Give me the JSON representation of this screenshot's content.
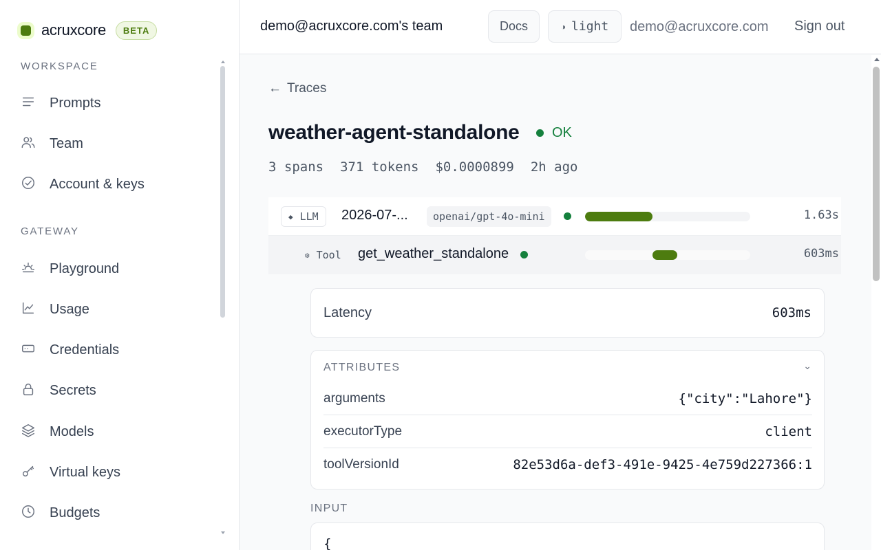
{
  "brand": {
    "name": "acruxcore",
    "badge": "BETA"
  },
  "sidebar": {
    "workspace_label": "WORKSPACE",
    "gateway_label": "GATEWAY",
    "items": [
      {
        "label": "Prompts",
        "icon": "lines-icon"
      },
      {
        "label": "Team",
        "icon": "users-icon"
      },
      {
        "label": "Account & keys",
        "icon": "check-circle-icon"
      },
      {
        "label": "Playground",
        "icon": "sun-icon"
      },
      {
        "label": "Usage",
        "icon": "chart-line-icon"
      },
      {
        "label": "Credentials",
        "icon": "card-icon"
      },
      {
        "label": "Secrets",
        "icon": "lock-icon"
      },
      {
        "label": "Models",
        "icon": "layers-icon"
      },
      {
        "label": "Virtual keys",
        "icon": "key-icon"
      },
      {
        "label": "Budgets",
        "icon": "clock-icon"
      }
    ]
  },
  "header": {
    "team": "demo@acruxcore.com's team",
    "docs": "Docs",
    "theme": "light",
    "email": "demo@acruxcore.com",
    "sign_out": "Sign out"
  },
  "trace": {
    "back": "Traces",
    "title": "weather-agent-standalone",
    "status": "OK",
    "spans": "3 spans",
    "tokens": "371 tokens",
    "cost": "$0.0000899",
    "age": "2h ago",
    "colors": {
      "accent": "#4d7c0f",
      "ok": "#15803d"
    },
    "rows": [
      {
        "kind": "LLM",
        "name": "2026-07-...",
        "model": "openai/gpt-4o-mini",
        "duration": "1.63s",
        "bar_start": 0.0,
        "bar_fraction": 0.41
      },
      {
        "kind": "Tool",
        "name": "get_weather_standalone",
        "duration": "603ms",
        "bar_start": 0.41,
        "bar_fraction": 0.15
      }
    ]
  },
  "detail": {
    "latency_label": "Latency",
    "latency_value": "603ms",
    "attributes_label": "ATTRIBUTES",
    "attributes": [
      {
        "key": "arguments",
        "value": "{\"city\":\"Lahore\"}"
      },
      {
        "key": "executorType",
        "value": "client"
      },
      {
        "key": "toolVersionId",
        "value": "82e53d6a-def3-491e-9425-4e759d227366:1"
      }
    ],
    "input_label": "INPUT",
    "input_first_line": "{"
  }
}
